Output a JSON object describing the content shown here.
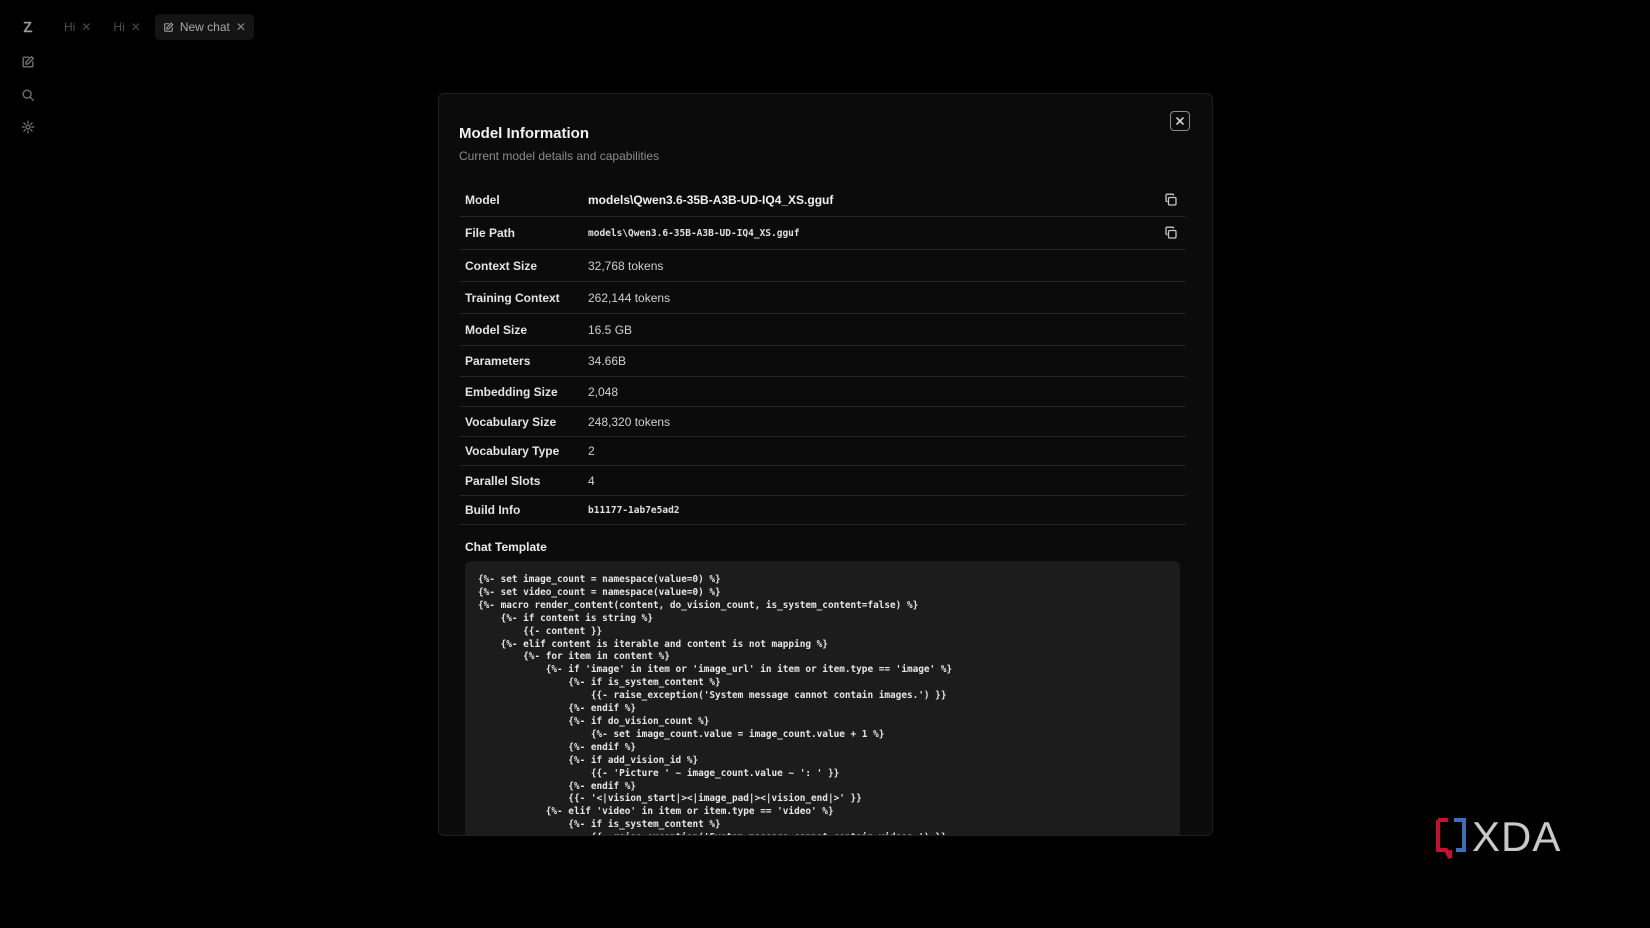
{
  "tabs": [
    {
      "label": "Hi",
      "active": false
    },
    {
      "label": "Hi",
      "active": false
    },
    {
      "label": "New chat",
      "active": true
    }
  ],
  "rail": {
    "icons": [
      "logo-icon",
      "new-chat-icon",
      "search-icon",
      "settings-icon"
    ]
  },
  "modal": {
    "title": "Model Information",
    "subtitle": "Current model details and capabilities",
    "rows": [
      {
        "key": "Model",
        "value": "models\\Qwen3.6-35B-A3B-UD-IQ4_XS.gguf",
        "copyable": true
      },
      {
        "key": "File Path",
        "value": "models\\Qwen3.6-35B-A3B-UD-IQ4_XS.gguf",
        "copyable": true
      },
      {
        "key": "Context Size",
        "value": "32,768 tokens"
      },
      {
        "key": "Training Context",
        "value": "262,144 tokens"
      },
      {
        "key": "Model Size",
        "value": "16.5 GB"
      },
      {
        "key": "Parameters",
        "value": "34.66B"
      },
      {
        "key": "Embedding Size",
        "value": "2,048"
      },
      {
        "key": "Vocabulary Size",
        "value": "248,320 tokens"
      },
      {
        "key": "Vocabulary Type",
        "value": "2"
      },
      {
        "key": "Parallel Slots",
        "value": "4"
      },
      {
        "key": "Build Info",
        "value": "b11177-1ab7e5ad2"
      }
    ],
    "chat_template_label": "Chat Template",
    "chat_template": "{%- set image_count = namespace(value=0) %}\n{%- set video_count = namespace(value=0) %}\n{%- macro render_content(content, do_vision_count, is_system_content=false) %}\n    {%- if content is string %}\n        {{- content }}\n    {%- elif content is iterable and content is not mapping %}\n        {%- for item in content %}\n            {%- if 'image' in item or 'image_url' in item or item.type == 'image' %}\n                {%- if is_system_content %}\n                    {{- raise_exception('System message cannot contain images.') }}\n                {%- endif %}\n                {%- if do_vision_count %}\n                    {%- set image_count.value = image_count.value + 1 %}\n                {%- endif %}\n                {%- if add_vision_id %}\n                    {{- 'Picture ' ~ image_count.value ~ ': ' }}\n                {%- endif %}\n                {{- '<|vision_start|><|image_pad|><|vision_end|>' }}\n            {%- elif 'video' in item or item.type == 'video' %}\n                {%- if is_system_content %}\n                    {{- raise_exception('System message cannot contain videos.') }}"
  },
  "watermark": {
    "text": "XDA",
    "accent_color": "#c8102e"
  }
}
